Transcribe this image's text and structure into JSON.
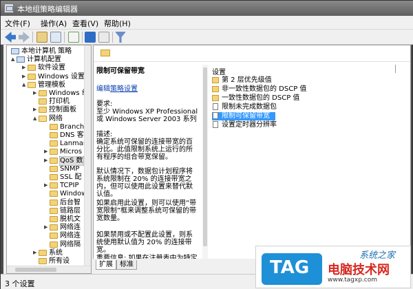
{
  "window": {
    "title": "本地组策略编辑器"
  },
  "menu": [
    "文件(F)",
    "操作(A)",
    "查看(V)",
    "帮助(H)"
  ],
  "tree": [
    {
      "label": "本地计算机 策略",
      "level": 0,
      "icon": "computer-icon",
      "expander": ""
    },
    {
      "label": "计算机配置",
      "level": 1,
      "icon": "computer-icon",
      "expander": "▲"
    },
    {
      "label": "软件设置",
      "level": 2,
      "icon": "folder-icon",
      "expander": "▶"
    },
    {
      "label": "Windows 设置",
      "level": 2,
      "icon": "folder-icon",
      "expander": "▶"
    },
    {
      "label": "管理模板",
      "level": 2,
      "icon": "folder-open-icon",
      "expander": "▲"
    },
    {
      "label": "Windows 组",
      "level": 3,
      "icon": "folder-icon",
      "expander": "▶"
    },
    {
      "label": "打印机",
      "level": 3,
      "icon": "folder-icon",
      "expander": ""
    },
    {
      "label": "控制面板",
      "level": 3,
      "icon": "folder-icon",
      "expander": "▶"
    },
    {
      "label": "网络",
      "level": 3,
      "icon": "folder-open-icon",
      "expander": "▲"
    },
    {
      "label": "Branch",
      "level": 4,
      "icon": "folder-icon",
      "expander": ""
    },
    {
      "label": "DNS 客",
      "level": 4,
      "icon": "folder-icon",
      "expander": ""
    },
    {
      "label": "Lanman",
      "level": 4,
      "icon": "folder-icon",
      "expander": ""
    },
    {
      "label": "Micros",
      "level": 4,
      "icon": "folder-icon",
      "expander": "▶"
    },
    {
      "label": "QoS 数",
      "level": 4,
      "icon": "folder-icon",
      "expander": "▶",
      "selected": true
    },
    {
      "label": "SNMP",
      "level": 4,
      "icon": "folder-icon",
      "expander": ""
    },
    {
      "label": "SSL 配",
      "level": 4,
      "icon": "folder-icon",
      "expander": ""
    },
    {
      "label": "TCPIP",
      "level": 4,
      "icon": "folder-icon",
      "expander": "▶"
    },
    {
      "label": "Window",
      "level": 4,
      "icon": "folder-icon",
      "expander": ""
    },
    {
      "label": "后台智",
      "level": 4,
      "icon": "folder-icon",
      "expander": ""
    },
    {
      "label": "链路层",
      "level": 4,
      "icon": "folder-icon",
      "expander": ""
    },
    {
      "label": "脱机文",
      "level": 4,
      "icon": "folder-icon",
      "expander": ""
    },
    {
      "label": "网络连",
      "level": 4,
      "icon": "folder-icon",
      "expander": "▶"
    },
    {
      "label": "网络连",
      "level": 4,
      "icon": "folder-icon",
      "expander": ""
    },
    {
      "label": "网络隔",
      "level": 4,
      "icon": "folder-icon",
      "expander": ""
    },
    {
      "label": "系统",
      "level": 3,
      "icon": "folder-icon",
      "expander": "▶"
    },
    {
      "label": "所有设",
      "level": 3,
      "icon": "folder-icon",
      "expander": ""
    }
  ],
  "description": {
    "title": "限制可保留带宽",
    "edit_prefix": "编辑",
    "edit_link": "策略设置",
    "requirements": "要求:\n至少 Windows XP Professional 或 Windows Server 2003 系列",
    "desc_body": "描述:\n确定系统可保留的连接带宽的百分比。此值限制系统上运行的所有程序的组合带宽保留。",
    "default_body": "默认情况下，数据包计划程序将系统限制在 20% 的连接带宽之内，但可以使用此设置来替代默认值。",
    "enabled_body": "如果启用此设置，则可以使用“带宽限制”框来调整系统可保留的带宽数量。",
    "disabled_body": "如果禁用或不配置此设置，则系统使用默认值为 20% 的连接带宽。",
    "important_body": "重要信息: 如果在注册表中为特定网络适配器设置带宽限制，配置该"
  },
  "list": {
    "header": "设置",
    "items": [
      {
        "label": "第 2 层优先级值",
        "icon": "folder-icon",
        "selected": false
      },
      {
        "label": "非一致性数据包的 DSCP 值",
        "icon": "folder-icon",
        "selected": false
      },
      {
        "label": "一致性数据包的 DSCP 值",
        "icon": "folder-icon",
        "selected": false
      },
      {
        "label": "限制未完成数据包",
        "icon": "setting-icon",
        "selected": false
      },
      {
        "label": "限制可保留带宽",
        "icon": "setting-icon",
        "selected": true
      },
      {
        "label": "设置定时器分辨率",
        "icon": "setting-icon",
        "selected": false
      }
    ]
  },
  "tabs": [
    "扩展",
    "标准"
  ],
  "status": {
    "text": "3 个设置"
  },
  "watermark": {
    "tag": "TAG",
    "big": "电脑技术网",
    "url": "www.tagxp.com",
    "top": "系统之家"
  }
}
